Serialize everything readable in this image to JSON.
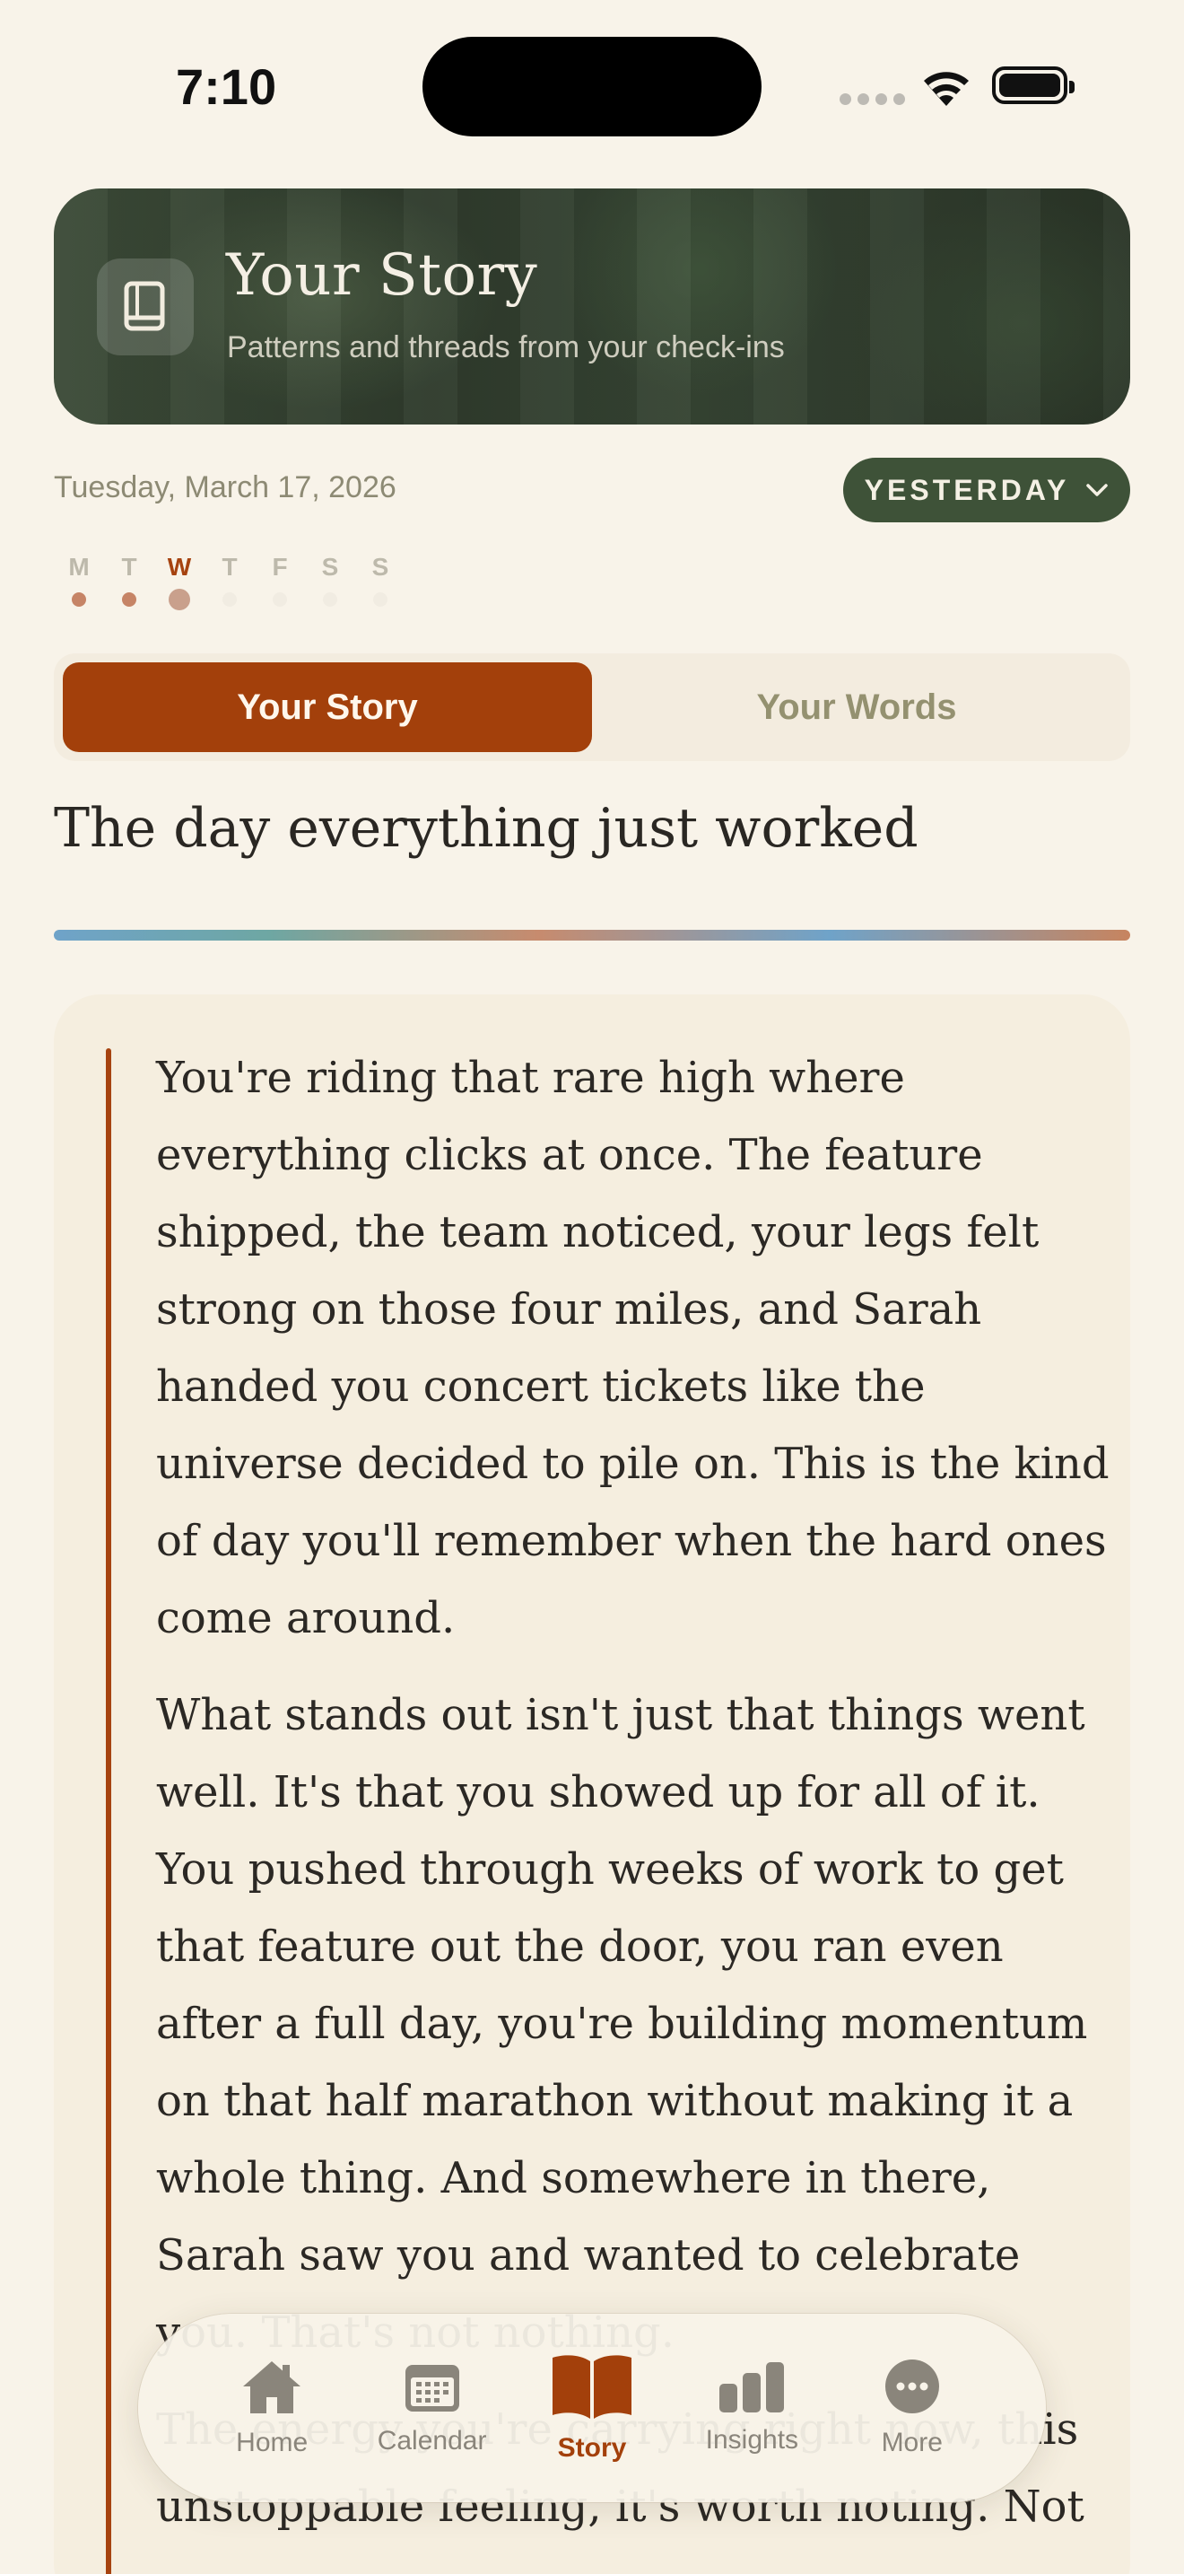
{
  "status_bar": {
    "time": "7:10"
  },
  "header": {
    "title": "Your Story",
    "subtitle": "Patterns and threads from your check-ins",
    "icon": "book-icon"
  },
  "date_row": {
    "date": "Tuesday, March 17, 2026",
    "selector_label": "YESTERDAY",
    "selector_icon": "chevron-down-icon"
  },
  "week": [
    {
      "label": "M",
      "state": "filled"
    },
    {
      "label": "T",
      "state": "filled"
    },
    {
      "label": "W",
      "state": "selected"
    },
    {
      "label": "T",
      "state": "empty"
    },
    {
      "label": "F",
      "state": "empty"
    },
    {
      "label": "S",
      "state": "empty"
    },
    {
      "label": "S",
      "state": "empty"
    }
  ],
  "tabs": {
    "story": "Your Story",
    "words": "Your Words"
  },
  "story": {
    "title": "The day everything just worked",
    "paragraphs": [
      "You're riding that rare high where everything clicks at once. The feature shipped, the team noticed, your legs felt strong on those four miles, and Sarah handed you concert tickets like the universe decided to pile on. This is the kind of day you'll remember when the hard ones come around.",
      "What stands out isn't just that things went well. It's that you showed up for all of it. You pushed through weeks of work to get that feature out the door, you ran even after a full day, you're building momentum on that half marathon without making it a whole thing. And somewhere in there, Sarah saw you and wanted to celebrate you. That's not nothing.",
      "The energy you're carrying right now, this unstoppable feeling, it's worth noting. Not"
    ]
  },
  "nav": [
    {
      "label": "Home",
      "icon": "home-icon"
    },
    {
      "label": "Calendar",
      "icon": "calendar-icon"
    },
    {
      "label": "Story",
      "icon": "open-book-icon",
      "active": true
    },
    {
      "label": "Insights",
      "icon": "bar-chart-icon"
    },
    {
      "label": "More",
      "icon": "more-icon"
    }
  ],
  "colors": {
    "accent": "#a3400b",
    "forest": "#3e5238",
    "background": "#f8f3e9"
  }
}
